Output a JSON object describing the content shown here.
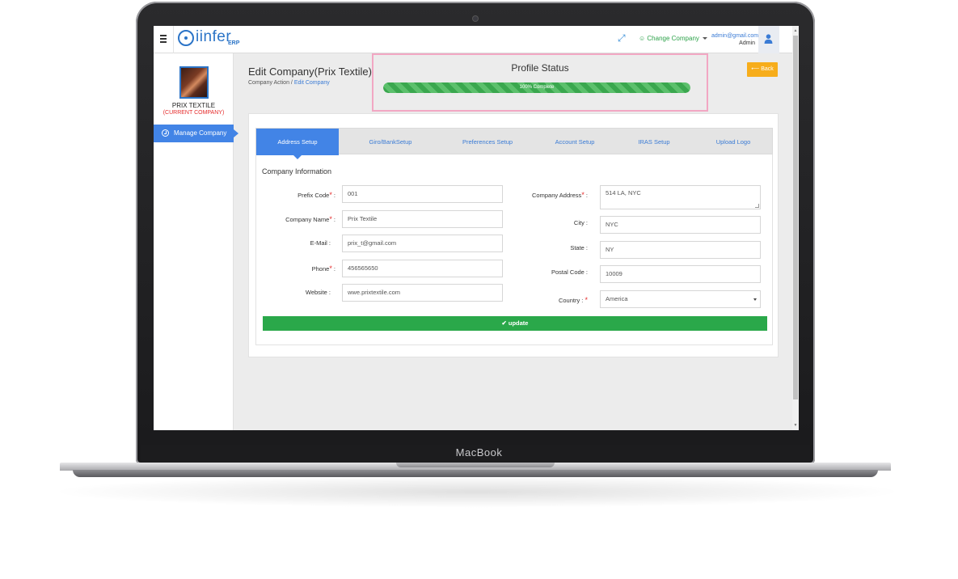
{
  "device": {
    "brand": "MacBook"
  },
  "app": {
    "logo_text": "iinfer",
    "logo_sub": "ERP"
  },
  "topbar": {
    "change_company": "Change Company",
    "user_email": "admin@gmail.com",
    "user_role": "Admin"
  },
  "sidebar": {
    "company_name": "PRIX TEXTILE",
    "company_tag": "(CURRENT COMPANY)",
    "items": [
      {
        "label": "Manage Company"
      }
    ]
  },
  "page": {
    "title": "Edit Company(Prix Textile)",
    "breadcrumb_root": "Company Action",
    "breadcrumb_sep": " / ",
    "breadcrumb_current": "Edit Company",
    "back_label": "Back"
  },
  "profile_status": {
    "title": "Profile Status",
    "progress": 100,
    "progress_label": "100% Complete"
  },
  "tabs": [
    {
      "label": "Address Setup",
      "active": true
    },
    {
      "label": "Giro/BankSetup",
      "active": false
    },
    {
      "label": "Preferences Setup",
      "active": false
    },
    {
      "label": "Account Setup",
      "active": false
    },
    {
      "label": "IRAS Setup",
      "active": false
    },
    {
      "label": "Upload Logo",
      "active": false
    }
  ],
  "form": {
    "section_title": "Company Information",
    "prefix_code": {
      "label": "Prefix Code",
      "value": "001"
    },
    "company_name": {
      "label": "Company Name",
      "value": "Prix Textile"
    },
    "email": {
      "label": "E-Mail :",
      "value": "prix_t@gmail.com"
    },
    "phone": {
      "label": "Phone",
      "value": "456565650"
    },
    "website": {
      "label": "Website :",
      "value": "wwe.prixtextile.com"
    },
    "company_address": {
      "label": "Company Address",
      "value": "514 LA, NYC"
    },
    "city": {
      "label": "City :",
      "value": "NYC"
    },
    "state": {
      "label": "State :",
      "value": "NY"
    },
    "postal_code": {
      "label": "Postal Code :",
      "value": "10009"
    },
    "country": {
      "label": "Country :",
      "value": "America"
    },
    "update_label": "update"
  },
  "colors": {
    "accent": "#4284e6",
    "success": "#2aa84a",
    "warning": "#f7ad1b",
    "danger": "#e52c2c",
    "highlight_border": "#f2a7c3"
  }
}
